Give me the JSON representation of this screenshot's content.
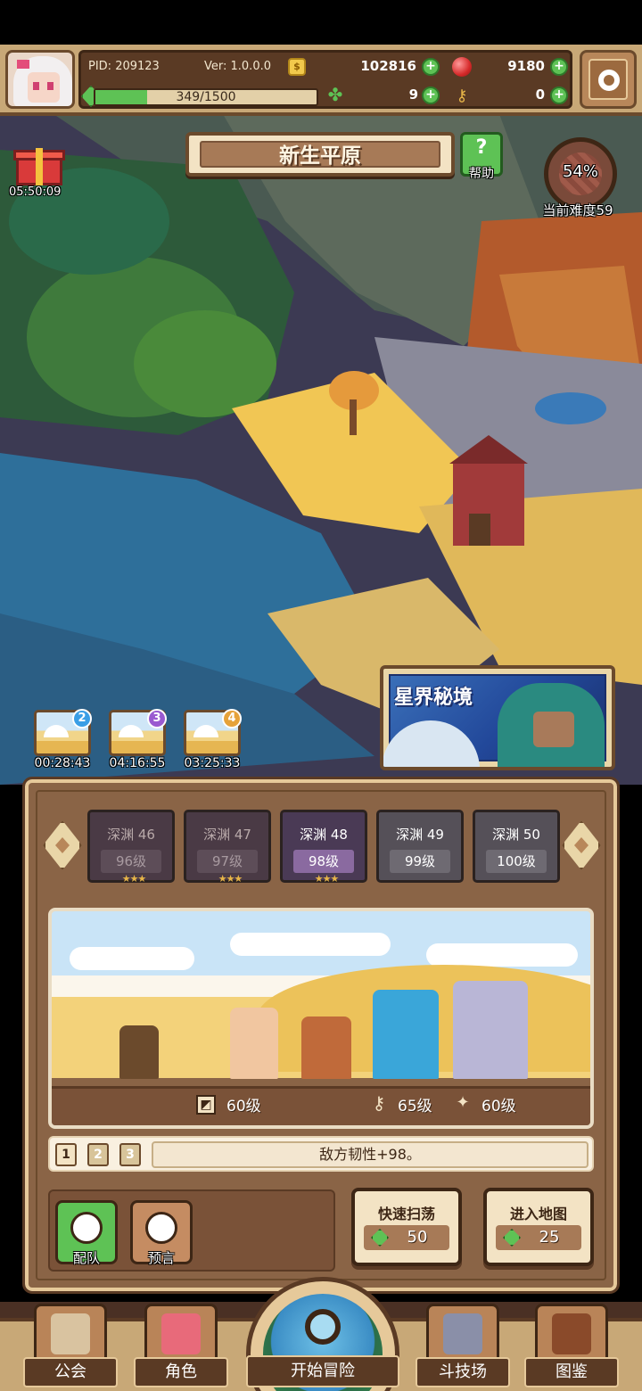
{
  "header": {
    "pid": "PID: 209123",
    "version": "Ver: 1.0.0.0",
    "gold": "102816",
    "ruby": "9180",
    "stamina": "349/1500",
    "stamina_ratio": 0.233,
    "clover": "9",
    "keys": "0",
    "gold_icon": "coin-icon",
    "settings_icon": "gear-icon"
  },
  "gift": {
    "timer": "05:50:09"
  },
  "map": {
    "title": "新生平原",
    "help_label": "帮助"
  },
  "difficulty": {
    "percent": "54%",
    "label": "当前难度59"
  },
  "event": {
    "title": "星界秘境"
  },
  "timer_slots": [
    {
      "badge": "2",
      "timer": "00:28:43",
      "color": "#3a9ee6"
    },
    {
      "badge": "3",
      "timer": "04:16:55",
      "color": "#9a5ad0"
    },
    {
      "badge": "4",
      "timer": "03:25:33",
      "color": "#e6a23a"
    }
  ],
  "levels": [
    {
      "name": "深渊 46",
      "level": "96级",
      "state": "locked",
      "stars": "★★★"
    },
    {
      "name": "深渊 47",
      "level": "97级",
      "state": "locked",
      "stars": "★★★"
    },
    {
      "name": "深渊 48",
      "level": "98级",
      "state": "current",
      "stars": "★★★"
    },
    {
      "name": "深渊 49",
      "level": "99级",
      "state": "avail",
      "stars": ""
    },
    {
      "name": "深渊 50",
      "level": "100级",
      "state": "avail",
      "stars": ""
    }
  ],
  "battle": {
    "stat1": "60级",
    "stat2": "65级",
    "stat3": "60级"
  },
  "affix": {
    "tabs": [
      "1",
      "2",
      "3"
    ],
    "text": "敌方韧性+98。"
  },
  "actions": {
    "team_label": "配队",
    "prophecy_label": "预言",
    "sweep": {
      "title": "快速扫荡",
      "cost": "50"
    },
    "enter": {
      "title": "进入地图",
      "cost": "25"
    }
  },
  "nav": {
    "guild": "公会",
    "character": "角色",
    "adventure": "开始冒险",
    "arena": "斗技场",
    "codex": "图鉴"
  },
  "colors": {
    "accent_green": "#5ec255",
    "frame_brown": "#6b4a2c",
    "parchment": "#f3e3c4"
  }
}
